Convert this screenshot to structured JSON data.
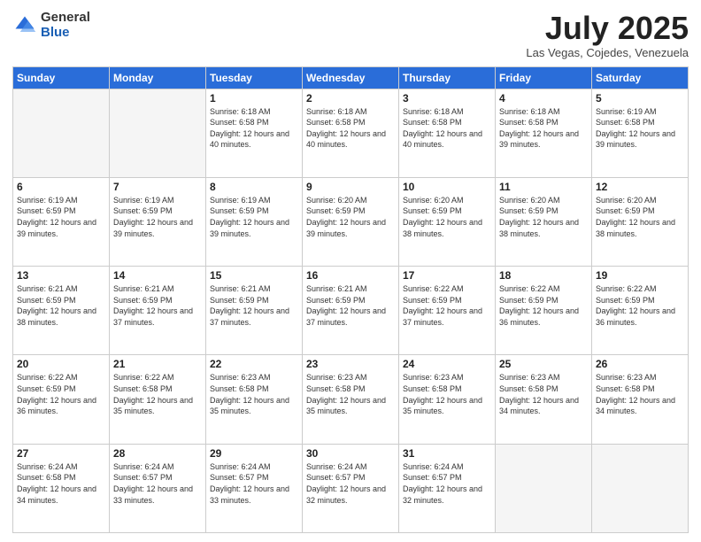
{
  "logo": {
    "general": "General",
    "blue": "Blue"
  },
  "header": {
    "month": "July 2025",
    "location": "Las Vegas, Cojedes, Venezuela"
  },
  "columns": [
    "Sunday",
    "Monday",
    "Tuesday",
    "Wednesday",
    "Thursday",
    "Friday",
    "Saturday"
  ],
  "weeks": [
    [
      {
        "day": "",
        "sunrise": "",
        "sunset": "",
        "daylight": ""
      },
      {
        "day": "",
        "sunrise": "",
        "sunset": "",
        "daylight": ""
      },
      {
        "day": "1",
        "sunrise": "Sunrise: 6:18 AM",
        "sunset": "Sunset: 6:58 PM",
        "daylight": "Daylight: 12 hours and 40 minutes."
      },
      {
        "day": "2",
        "sunrise": "Sunrise: 6:18 AM",
        "sunset": "Sunset: 6:58 PM",
        "daylight": "Daylight: 12 hours and 40 minutes."
      },
      {
        "day": "3",
        "sunrise": "Sunrise: 6:18 AM",
        "sunset": "Sunset: 6:58 PM",
        "daylight": "Daylight: 12 hours and 40 minutes."
      },
      {
        "day": "4",
        "sunrise": "Sunrise: 6:18 AM",
        "sunset": "Sunset: 6:58 PM",
        "daylight": "Daylight: 12 hours and 39 minutes."
      },
      {
        "day": "5",
        "sunrise": "Sunrise: 6:19 AM",
        "sunset": "Sunset: 6:58 PM",
        "daylight": "Daylight: 12 hours and 39 minutes."
      }
    ],
    [
      {
        "day": "6",
        "sunrise": "Sunrise: 6:19 AM",
        "sunset": "Sunset: 6:59 PM",
        "daylight": "Daylight: 12 hours and 39 minutes."
      },
      {
        "day": "7",
        "sunrise": "Sunrise: 6:19 AM",
        "sunset": "Sunset: 6:59 PM",
        "daylight": "Daylight: 12 hours and 39 minutes."
      },
      {
        "day": "8",
        "sunrise": "Sunrise: 6:19 AM",
        "sunset": "Sunset: 6:59 PM",
        "daylight": "Daylight: 12 hours and 39 minutes."
      },
      {
        "day": "9",
        "sunrise": "Sunrise: 6:20 AM",
        "sunset": "Sunset: 6:59 PM",
        "daylight": "Daylight: 12 hours and 39 minutes."
      },
      {
        "day": "10",
        "sunrise": "Sunrise: 6:20 AM",
        "sunset": "Sunset: 6:59 PM",
        "daylight": "Daylight: 12 hours and 38 minutes."
      },
      {
        "day": "11",
        "sunrise": "Sunrise: 6:20 AM",
        "sunset": "Sunset: 6:59 PM",
        "daylight": "Daylight: 12 hours and 38 minutes."
      },
      {
        "day": "12",
        "sunrise": "Sunrise: 6:20 AM",
        "sunset": "Sunset: 6:59 PM",
        "daylight": "Daylight: 12 hours and 38 minutes."
      }
    ],
    [
      {
        "day": "13",
        "sunrise": "Sunrise: 6:21 AM",
        "sunset": "Sunset: 6:59 PM",
        "daylight": "Daylight: 12 hours and 38 minutes."
      },
      {
        "day": "14",
        "sunrise": "Sunrise: 6:21 AM",
        "sunset": "Sunset: 6:59 PM",
        "daylight": "Daylight: 12 hours and 37 minutes."
      },
      {
        "day": "15",
        "sunrise": "Sunrise: 6:21 AM",
        "sunset": "Sunset: 6:59 PM",
        "daylight": "Daylight: 12 hours and 37 minutes."
      },
      {
        "day": "16",
        "sunrise": "Sunrise: 6:21 AM",
        "sunset": "Sunset: 6:59 PM",
        "daylight": "Daylight: 12 hours and 37 minutes."
      },
      {
        "day": "17",
        "sunrise": "Sunrise: 6:22 AM",
        "sunset": "Sunset: 6:59 PM",
        "daylight": "Daylight: 12 hours and 37 minutes."
      },
      {
        "day": "18",
        "sunrise": "Sunrise: 6:22 AM",
        "sunset": "Sunset: 6:59 PM",
        "daylight": "Daylight: 12 hours and 36 minutes."
      },
      {
        "day": "19",
        "sunrise": "Sunrise: 6:22 AM",
        "sunset": "Sunset: 6:59 PM",
        "daylight": "Daylight: 12 hours and 36 minutes."
      }
    ],
    [
      {
        "day": "20",
        "sunrise": "Sunrise: 6:22 AM",
        "sunset": "Sunset: 6:59 PM",
        "daylight": "Daylight: 12 hours and 36 minutes."
      },
      {
        "day": "21",
        "sunrise": "Sunrise: 6:22 AM",
        "sunset": "Sunset: 6:58 PM",
        "daylight": "Daylight: 12 hours and 35 minutes."
      },
      {
        "day": "22",
        "sunrise": "Sunrise: 6:23 AM",
        "sunset": "Sunset: 6:58 PM",
        "daylight": "Daylight: 12 hours and 35 minutes."
      },
      {
        "day": "23",
        "sunrise": "Sunrise: 6:23 AM",
        "sunset": "Sunset: 6:58 PM",
        "daylight": "Daylight: 12 hours and 35 minutes."
      },
      {
        "day": "24",
        "sunrise": "Sunrise: 6:23 AM",
        "sunset": "Sunset: 6:58 PM",
        "daylight": "Daylight: 12 hours and 35 minutes."
      },
      {
        "day": "25",
        "sunrise": "Sunrise: 6:23 AM",
        "sunset": "Sunset: 6:58 PM",
        "daylight": "Daylight: 12 hours and 34 minutes."
      },
      {
        "day": "26",
        "sunrise": "Sunrise: 6:23 AM",
        "sunset": "Sunset: 6:58 PM",
        "daylight": "Daylight: 12 hours and 34 minutes."
      }
    ],
    [
      {
        "day": "27",
        "sunrise": "Sunrise: 6:24 AM",
        "sunset": "Sunset: 6:58 PM",
        "daylight": "Daylight: 12 hours and 34 minutes."
      },
      {
        "day": "28",
        "sunrise": "Sunrise: 6:24 AM",
        "sunset": "Sunset: 6:57 PM",
        "daylight": "Daylight: 12 hours and 33 minutes."
      },
      {
        "day": "29",
        "sunrise": "Sunrise: 6:24 AM",
        "sunset": "Sunset: 6:57 PM",
        "daylight": "Daylight: 12 hours and 33 minutes."
      },
      {
        "day": "30",
        "sunrise": "Sunrise: 6:24 AM",
        "sunset": "Sunset: 6:57 PM",
        "daylight": "Daylight: 12 hours and 32 minutes."
      },
      {
        "day": "31",
        "sunrise": "Sunrise: 6:24 AM",
        "sunset": "Sunset: 6:57 PM",
        "daylight": "Daylight: 12 hours and 32 minutes."
      },
      {
        "day": "",
        "sunrise": "",
        "sunset": "",
        "daylight": ""
      },
      {
        "day": "",
        "sunrise": "",
        "sunset": "",
        "daylight": ""
      }
    ]
  ]
}
